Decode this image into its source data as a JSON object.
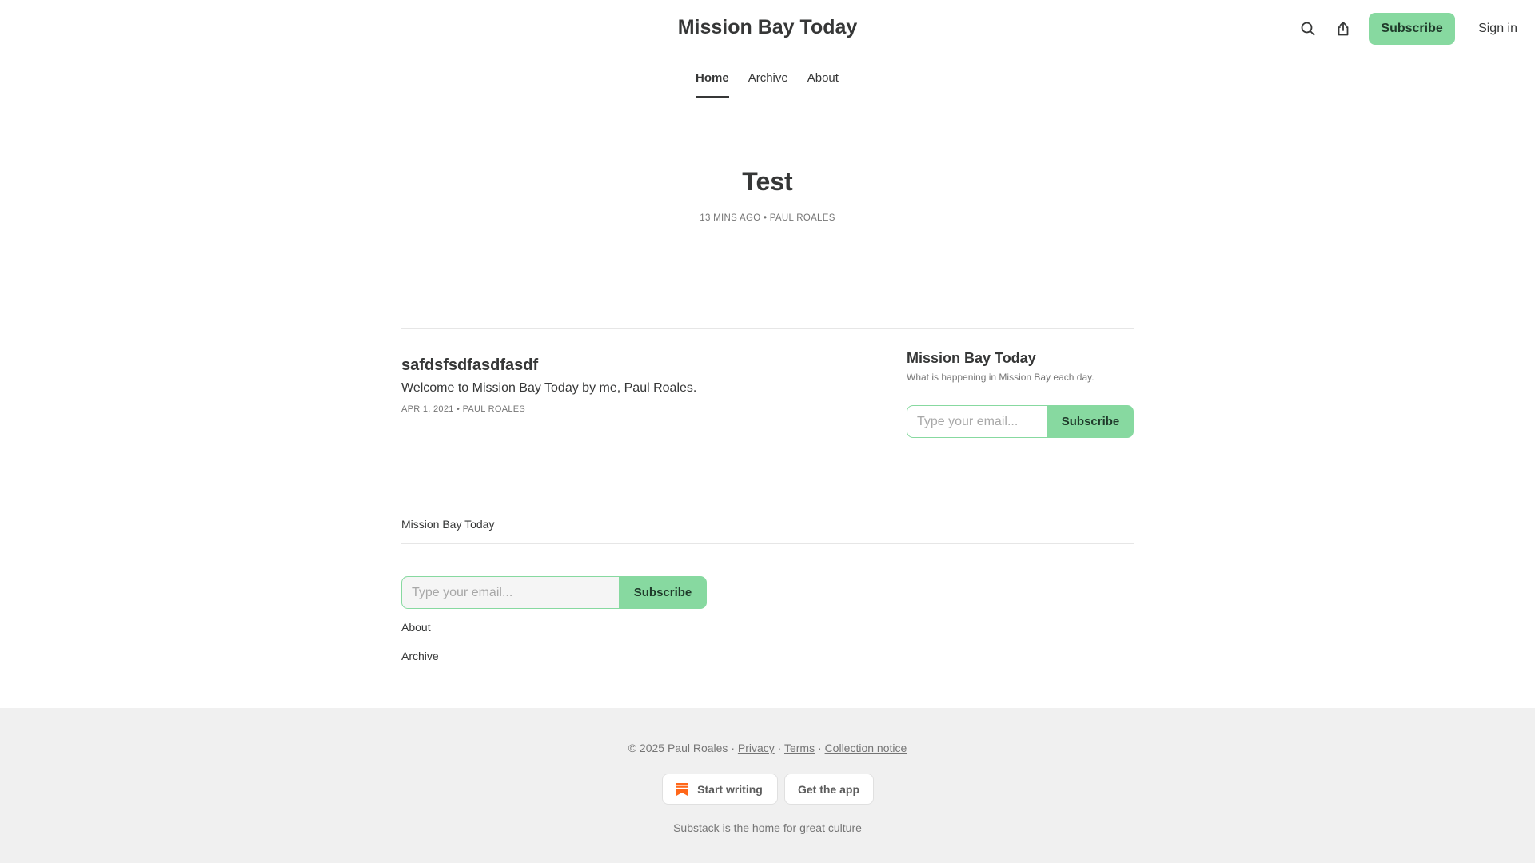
{
  "header": {
    "title": "Mission Bay Today",
    "search_icon": "search-icon",
    "share_icon": "share-icon",
    "subscribe_label": "Subscribe",
    "signin_label": "Sign in"
  },
  "nav": {
    "tabs": [
      {
        "label": "Home",
        "active": true
      },
      {
        "label": "Archive",
        "active": false
      },
      {
        "label": "About",
        "active": false
      }
    ]
  },
  "hero": {
    "title": "Test",
    "time": "13 MINS AGO",
    "separator": "•",
    "author": "PAUL ROALES"
  },
  "post": {
    "title": "safdsfsdfasdfasdf",
    "subtitle": "Welcome to Mission Bay Today by me, Paul Roales.",
    "date": "APR 1, 2021",
    "separator": "•",
    "author": "PAUL ROALES"
  },
  "sidebar": {
    "title": "Mission Bay Today",
    "description": "What is happening in Mission Bay each day.",
    "email_placeholder": "Type your email...",
    "subscribe_label": "Subscribe"
  },
  "site_footer": {
    "name": "Mission Bay Today",
    "email_placeholder": "Type your email...",
    "subscribe_label": "Subscribe",
    "links": [
      "About",
      "Archive"
    ]
  },
  "legal": {
    "copyright": "© 2025 Paul Roales ·",
    "privacy": "Privacy",
    "terms": "Terms",
    "collection": "Collection notice",
    "dot": "·",
    "start_writing": "Start writing",
    "get_app": "Get the app",
    "substack": "Substack",
    "tagline_rest": "is the home for great culture"
  },
  "colors": {
    "accent": "#87d9a0",
    "text": "#363737",
    "muted": "#757575",
    "footer_bg": "#f0f0f0",
    "substack_orange": "#ff6719"
  }
}
